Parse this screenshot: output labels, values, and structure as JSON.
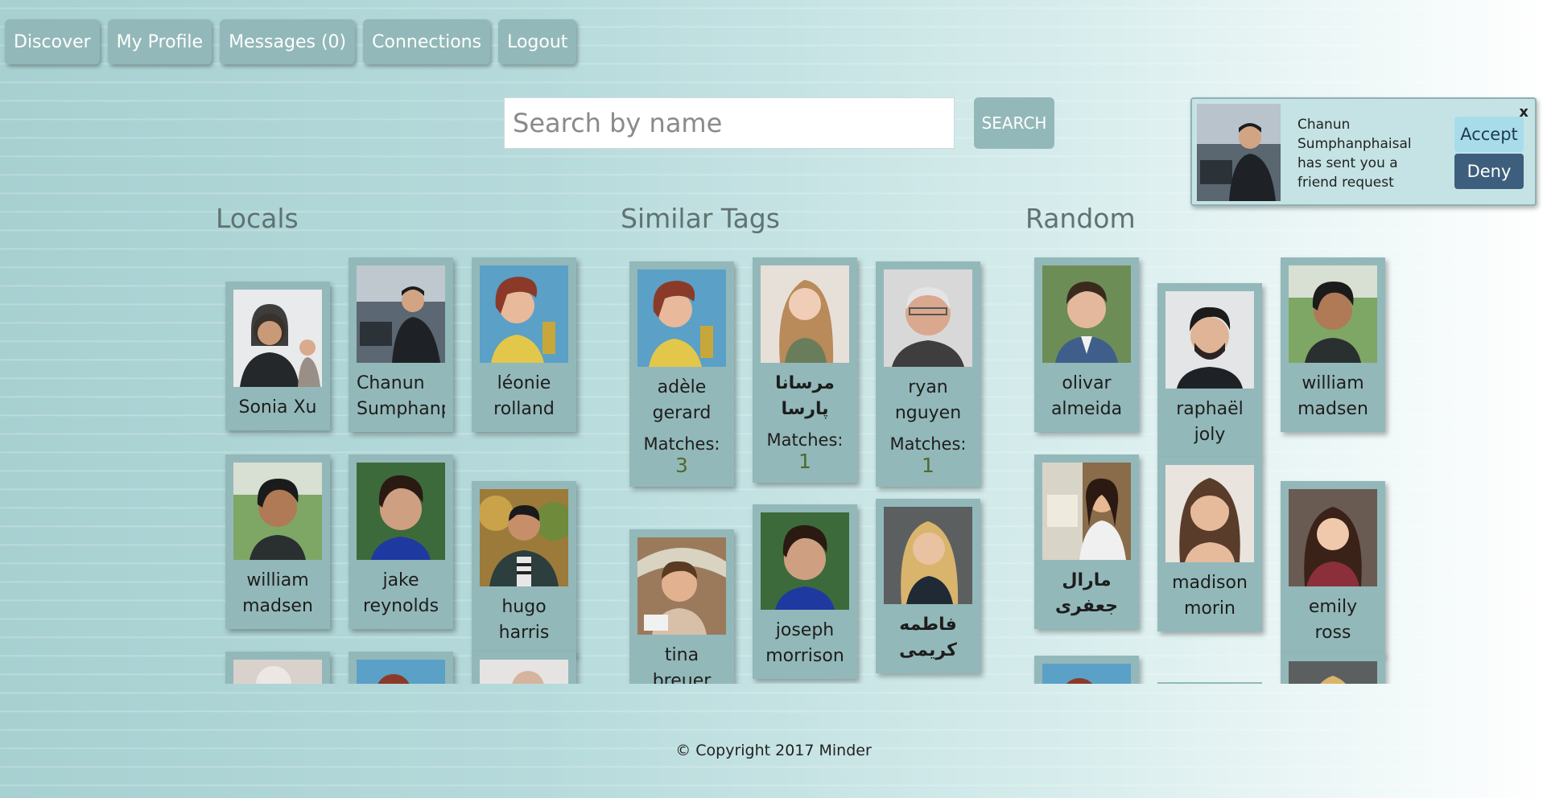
{
  "nav": {
    "items": [
      "Discover",
      "My Profile",
      "Messages (0)",
      "Connections",
      "Logout"
    ]
  },
  "search": {
    "placeholder": "Search by name",
    "button": "SEARCH"
  },
  "notification": {
    "close": "x",
    "text": "Chanun Sumphanphaisal has sent you a friend request",
    "accept": "Accept",
    "deny": "Deny"
  },
  "sections": {
    "locals": "Locals",
    "similar": "Similar Tags",
    "random": "Random"
  },
  "locals": [
    {
      "name": "Sonia Xu"
    },
    {
      "name": "Chanun\nSumphanphaisal"
    },
    {
      "name": "léonie\nrolland"
    },
    {
      "name": "william\nmadsen"
    },
    {
      "name": "jake\nreynolds"
    },
    {
      "name": "hugo harris"
    }
  ],
  "similar": [
    {
      "name": "adèle\ngerard",
      "matches_label": "Matches: ",
      "matches": "3"
    },
    {
      "name": "مرسانا\nپارسا",
      "matches_label": "Matches: ",
      "matches": "1"
    },
    {
      "name": "ryan\nnguyen",
      "matches_label": "Matches: ",
      "matches": "1"
    },
    {
      "name": "tina breuer"
    },
    {
      "name": "joseph\nmorrison"
    },
    {
      "name": "فاطمه\nکریمی"
    }
  ],
  "random": [
    {
      "name": "olivar\nalmeida"
    },
    {
      "name": "raphaël joly"
    },
    {
      "name": "william\nmadsen"
    },
    {
      "name": "مارال\nجعفری"
    },
    {
      "name": "madison\nmorin"
    },
    {
      "name": "emily ross"
    }
  ],
  "footer": "© Copyright 2017 Minder"
}
